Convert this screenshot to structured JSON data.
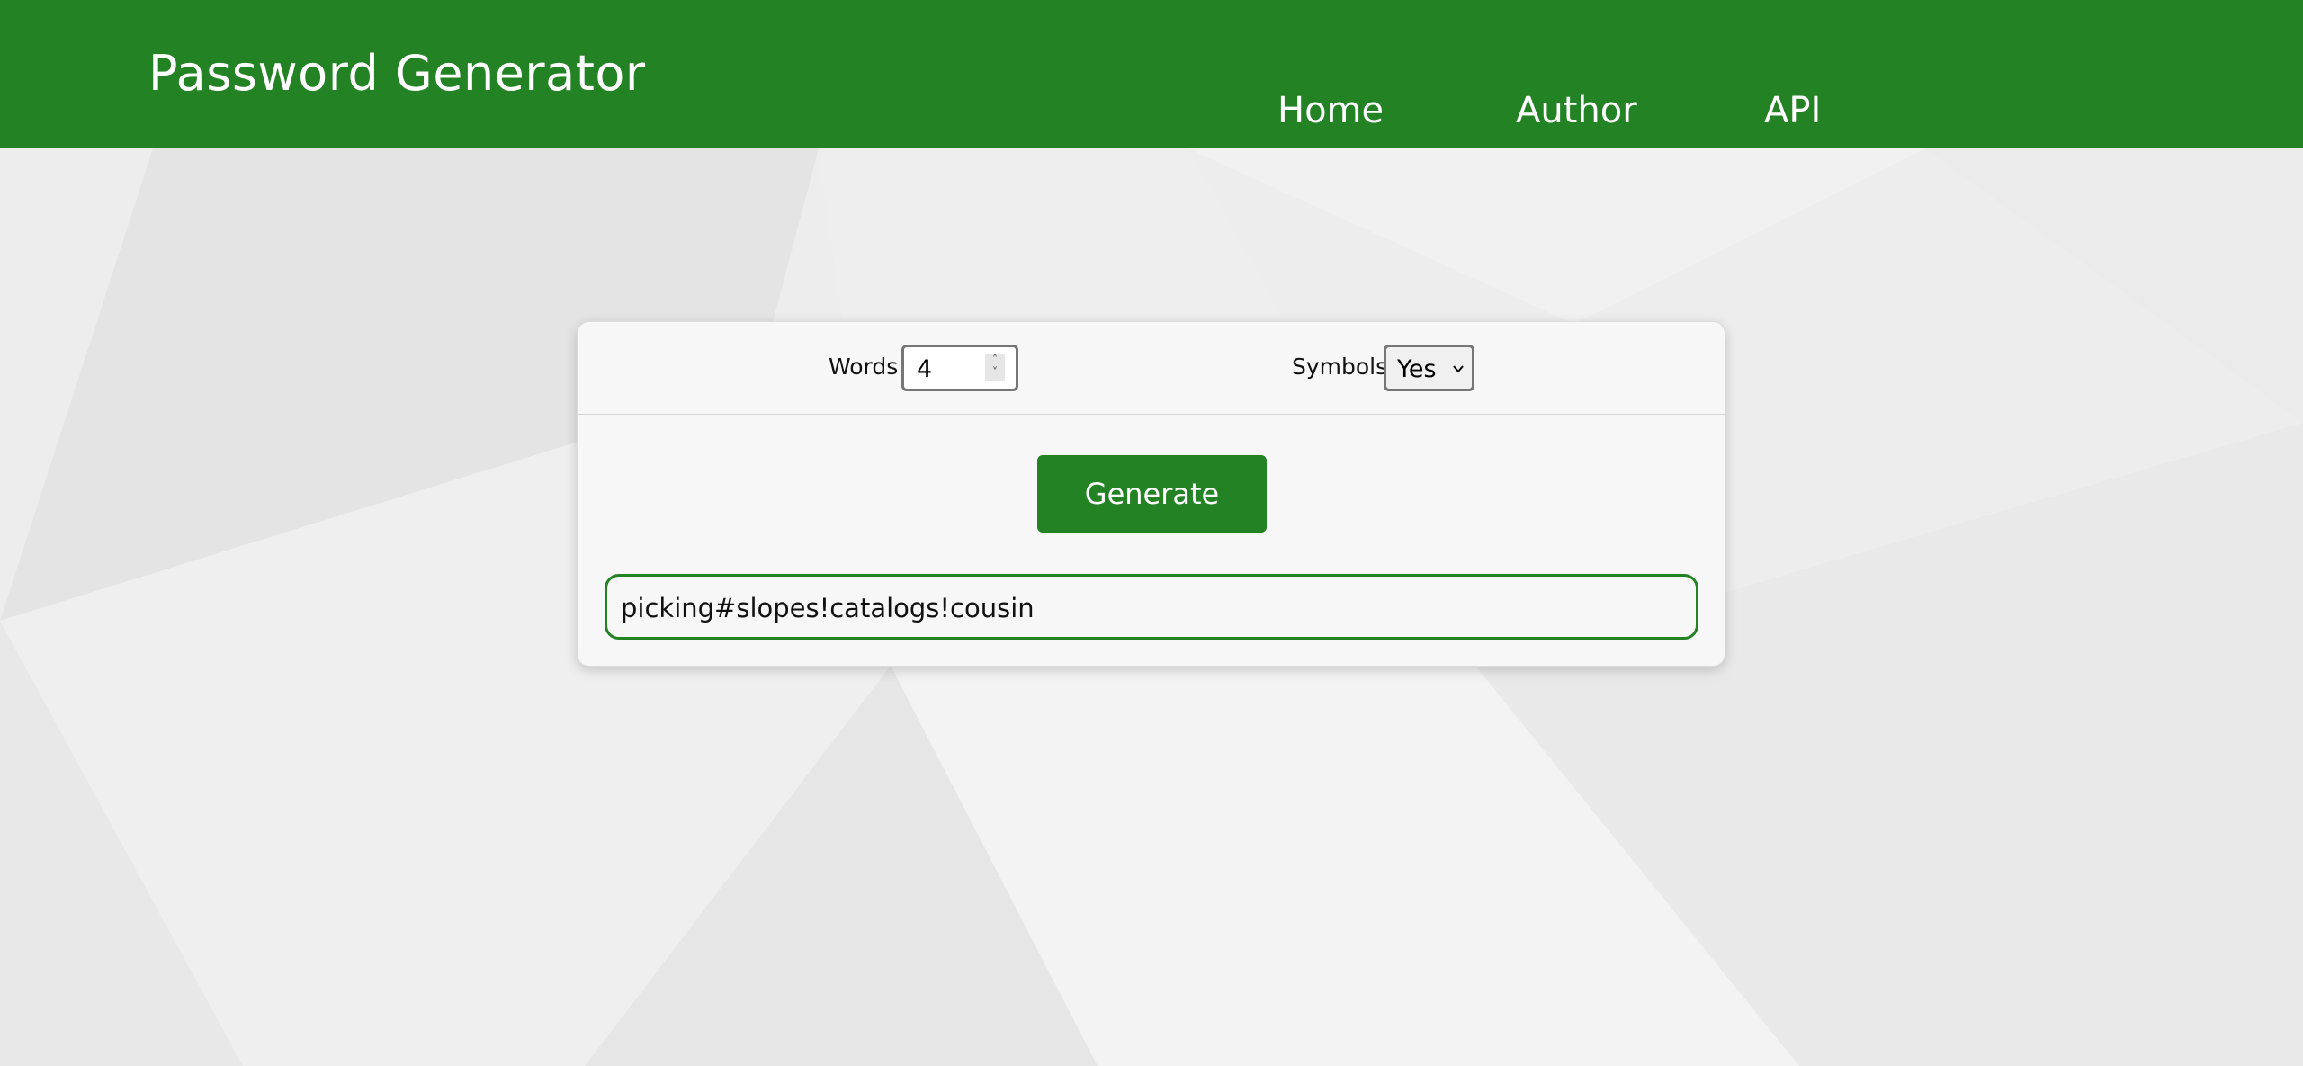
{
  "header": {
    "title": "Password Generator",
    "nav": [
      {
        "label": "Home"
      },
      {
        "label": "Author"
      },
      {
        "label": "API"
      }
    ]
  },
  "form": {
    "words_label": "Words:",
    "words_value": "4",
    "symbols_label": "Symbols:",
    "symbols_selected": "Yes",
    "generate_label": "Generate",
    "password": "picking#slopes!catalogs!cousin"
  },
  "colors": {
    "brand_green": "#228224",
    "background": "#ececec"
  },
  "icons": {
    "spinner": "number-spinner-icon",
    "select_chevron": "chevron-down-icon"
  }
}
